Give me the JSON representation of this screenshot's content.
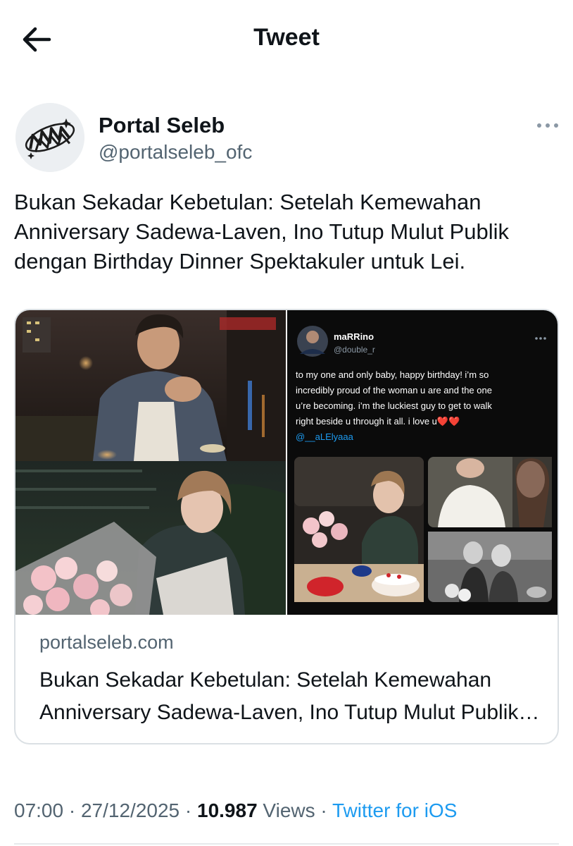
{
  "header": {
    "title": "Tweet",
    "back_icon": "arrow-left-icon"
  },
  "author": {
    "name": "Portal Seleb",
    "handle": "@portalseleb_ofc",
    "avatar_logo_text": "PORTAL SELEB",
    "more_icon": "more-horizontal-icon"
  },
  "tweet": {
    "text": "Bukan Sekadar Kebetulan: Setelah Kemewahan Anniversary Sadewa-Laven, Ino Tutup Mulut Publik dengan Birthday Dinner Spektakuler untuk Lei."
  },
  "link_card": {
    "domain": "portalseleb.com",
    "title": "Bukan Sekadar Kebetulan: Setelah Kemewahan Anniversary Sadewa-Laven, Ino Tutup Mulut Publik dengan Birthday Dinner Spektakuler untuk Lei.",
    "embedded_post": {
      "name": "maRRino",
      "handle": "@double_r",
      "text_lines": [
        "to my one and only baby, happy birthday! i’m so",
        "incredibly proud of the woman u are and the one",
        "u’re becoming. i’m the luckiest guy to get to walk",
        "right beside u through it all. i love u❤️❤️"
      ],
      "mention": "@__aLElyaaa",
      "more_icon": "more-horizontal-icon"
    }
  },
  "meta": {
    "time": "07:00",
    "separator": "·",
    "date": "27/12/2025",
    "views_count": "10.987",
    "views_label": "Views",
    "source": "Twitter for iOS"
  },
  "colors": {
    "text": "#0f1419",
    "secondary": "#536471",
    "link": "#1d9bf0",
    "border": "#dbe0e4"
  }
}
